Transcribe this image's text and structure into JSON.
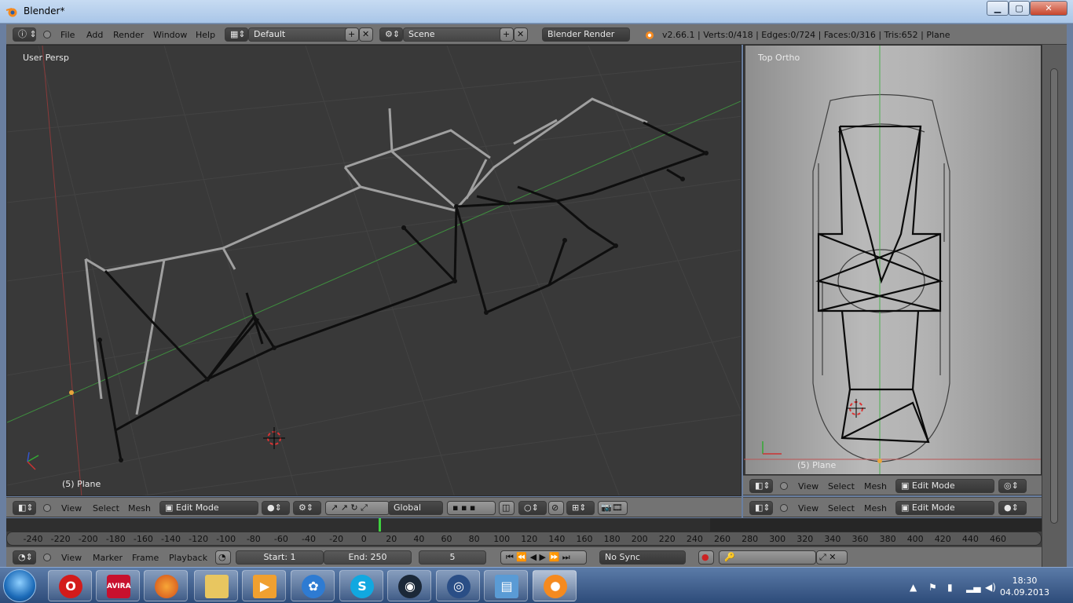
{
  "window": {
    "title": "Blender*",
    "controls": {
      "minimize": "▁",
      "maximize": "▢",
      "close": "✕"
    }
  },
  "info_header": {
    "menus": [
      "File",
      "Add",
      "Render",
      "Window",
      "Help"
    ],
    "layout": "Default",
    "scene": "Scene",
    "engine": "Blender Render",
    "stats": "v2.66.1 | Verts:0/418 | Edges:0/724 | Faces:0/316 | Tris:652 | Plane"
  },
  "viewport_main": {
    "view_label": "User Persp",
    "object_label": "(5) Plane"
  },
  "viewport_top": {
    "view_label": "Top Ortho",
    "object_label": "(5) Plane"
  },
  "header_3d": {
    "menus": [
      "View",
      "Select",
      "Mesh"
    ],
    "mode": "Edit Mode",
    "orientation": "Global"
  },
  "header_top": {
    "menus": [
      "View",
      "Select",
      "Mesh"
    ],
    "mode": "Edit Mode"
  },
  "header_top2": {
    "menus": [
      "View",
      "Select",
      "Mesh"
    ],
    "mode": "Edit Mode"
  },
  "timeline": {
    "ticks": [
      "-240",
      "-220",
      "-200",
      "-180",
      "-160",
      "-140",
      "-120",
      "-100",
      "-80",
      "-60",
      "-40",
      "-20",
      "0",
      "20",
      "40",
      "60",
      "80",
      "100",
      "120",
      "140",
      "160",
      "180",
      "200",
      "220",
      "240",
      "260",
      "280",
      "300",
      "320",
      "340",
      "360",
      "380",
      "400",
      "420",
      "440",
      "460"
    ],
    "current_frame": "5"
  },
  "timeline_header": {
    "menus": [
      "View",
      "Marker",
      "Frame",
      "Playback"
    ],
    "start": "Start: 1",
    "end": "End: 250",
    "frame": "5",
    "sync": "No Sync"
  },
  "taskbar": {
    "apps": [
      "opera-icon",
      "avira-icon",
      "firefox-icon",
      "explorer-icon",
      "media-player-icon",
      "app-icon",
      "skype-icon",
      "steam-icon",
      "camera-icon",
      "image-viewer-icon",
      "blender-icon"
    ],
    "avira_label": "AVIRA",
    "time": "18:30",
    "date": "04.09.2013"
  }
}
